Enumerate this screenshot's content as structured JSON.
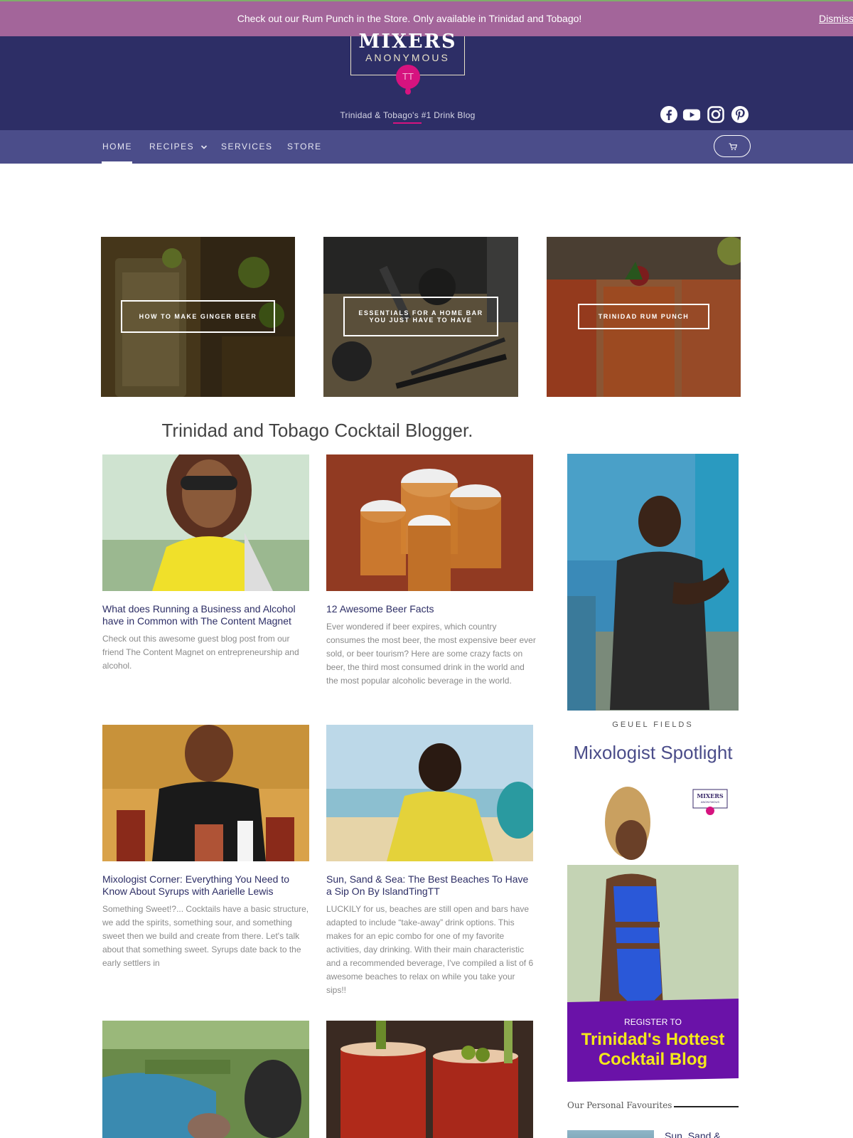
{
  "notice": {
    "text": "Check out our Rum Punch in the Store. Only available in Trinidad and Tobago!",
    "dismiss_label": "Dismiss"
  },
  "header": {
    "logo_top": "MIXERS",
    "logo_bottom": "ANONYMOUS",
    "logo_badge": "TT",
    "tagline": "Trinidad & Tobago's #1 Drink Blog",
    "socials": [
      "facebook-icon",
      "youtube-icon",
      "instagram-icon",
      "pinterest-icon"
    ]
  },
  "nav": {
    "items": [
      {
        "label": "HOME",
        "active": true
      },
      {
        "label": "RECIPES",
        "has_dropdown": true
      },
      {
        "label": "SERVICES"
      },
      {
        "label": "STORE"
      }
    ],
    "cart_icon": "cart-icon"
  },
  "featured": [
    {
      "label": "HOW TO MAKE GINGER BEER"
    },
    {
      "label": "ESSENTIALS FOR A HOME BAR YOU JUST HAVE TO HAVE"
    },
    {
      "label": "TRINIDAD RUM PUNCH"
    }
  ],
  "section_heading": "Trinidad and Tobago Cocktail Blogger.",
  "posts": [
    {
      "title": "What does Running a Business and Alcohol have in Common with The Content Magnet",
      "excerpt": "Check out this awesome guest blog post from our friend The Content Magnet on entrepreneurship and alcohol."
    },
    {
      "title": "12 Awesome Beer Facts",
      "excerpt": "Ever wondered if beer expires, which country consumes the most beer, the most expensive beer ever sold, or beer tourism? Here are some crazy facts on beer, the third most consumed drink in the world and the most popular alcoholic beverage in the world."
    },
    {
      "title": "Mixologist Corner: Everything You Need to Know About Syrups with Aarielle Lewis",
      "excerpt": "Something Sweet!?... Cocktails have a basic structure, we add the spirits, something sour, and something sweet then we build and create from there. Let's talk about that something sweet. Syrups date back to the early settlers in"
    },
    {
      "title": "Sun, Sand & Sea: The Best Beaches To Have a Sip On By IslandTingTT",
      "excerpt": "LUCKILY for us, beaches are still open and bars have adapted to include “take-away” drink options. This makes for an epic combo for one of my favorite activities, day drinking. With their main characteristic and a recommended beverage, I've compiled a list of 6 awesome beaches to relax on while you take your sips!!"
    }
  ],
  "sidebar": {
    "spotlight_name": "GEUEL FIELDS",
    "spotlight_heading": "Mixologist Spotlight",
    "ad": {
      "logo_top": "MIXERS",
      "logo_bottom": "ANONYMOUS",
      "register": "REGISTER TO",
      "line1": "Trinidad's Hottest",
      "line2": "Cocktail Blog"
    },
    "favourites_heading": "Our Personal Favourites",
    "favourite_link": "Sun, Sand &"
  }
}
